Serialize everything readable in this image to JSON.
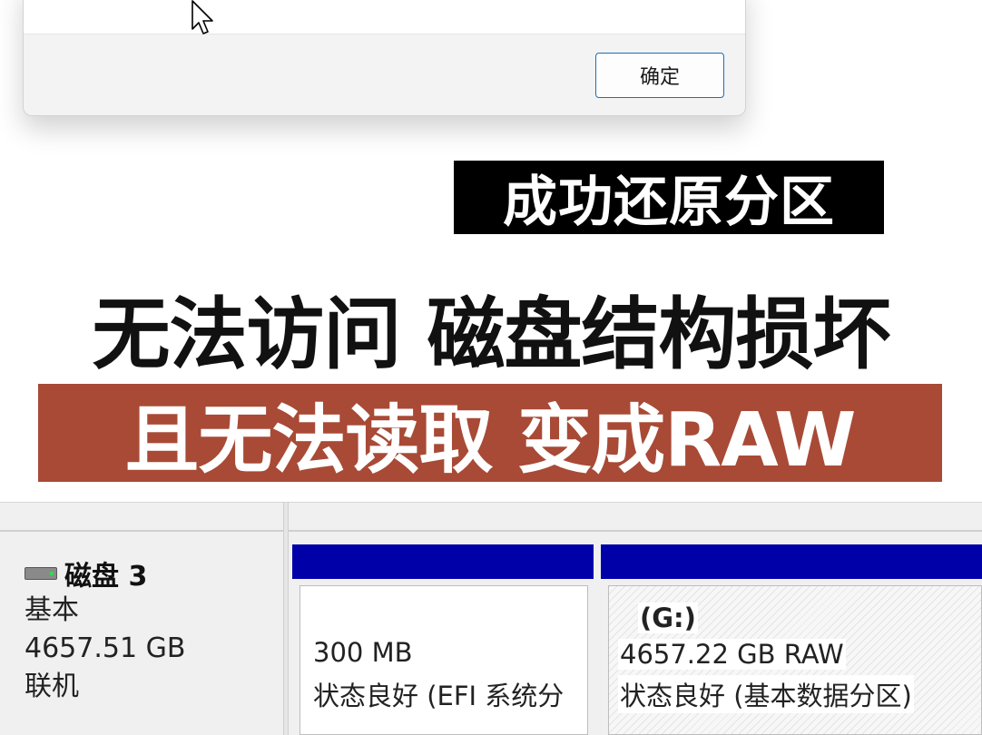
{
  "dialog": {
    "ok_label": "确定"
  },
  "captions": {
    "top": "成功还原分区",
    "middle": "无法访问 磁盘结构损坏",
    "bottom": "且无法读取 变成RAW"
  },
  "disk": {
    "name": "磁盘 3",
    "type": "基本",
    "size": "4657.51 GB",
    "status": "联机"
  },
  "partitions": [
    {
      "size": "300 MB",
      "status": "状态良好 (EFI 系统分"
    },
    {
      "drive": "(G:)",
      "size": "4657.22 GB RAW",
      "status": "状态良好 (基本数据分区)"
    }
  ],
  "colors": {
    "partition_header": "#0000a8",
    "caption_red": "#a84a36",
    "caption_black": "#000000"
  }
}
